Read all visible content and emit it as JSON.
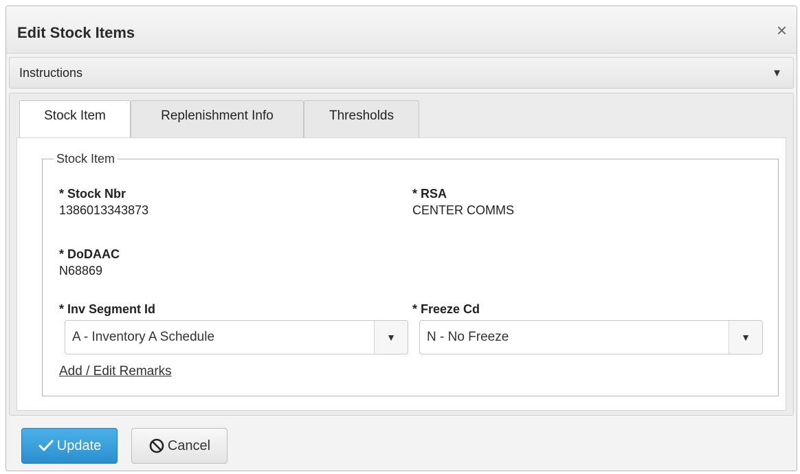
{
  "dialog": {
    "title": "Edit Stock Items",
    "close_icon": "close-icon",
    "close_glyph": "×"
  },
  "instructions": {
    "label": "Instructions",
    "icon": "caret-down-icon",
    "glyph": "▼"
  },
  "tabs": [
    {
      "label": "Stock Item",
      "active": true
    },
    {
      "label": "Replenishment Info",
      "active": false
    },
    {
      "label": "Thresholds",
      "active": false
    }
  ],
  "stock_item": {
    "legend": "Stock Item",
    "stock_nbr_label": "* Stock Nbr",
    "stock_nbr_value": "1386013343873",
    "rsa_label": "* RSA",
    "rsa_value": "CENTER COMMS",
    "dodaac_label": "* DoDAAC",
    "dodaac_value": "N68869",
    "inv_segment_label": "* Inv Segment Id",
    "inv_segment_value": "A - Inventory A Schedule",
    "freeze_label": "* Freeze Cd",
    "freeze_value": "N - No Freeze",
    "select_glyph": "▼",
    "remarks_link": "Add / Edit Remarks"
  },
  "buttons": {
    "update_label": "Update",
    "update_icon": "checkmark-icon",
    "cancel_label": "Cancel",
    "cancel_icon": "prohibited-icon"
  },
  "colors": {
    "primary": "#2a8fd0",
    "background": "#f3f3f3"
  }
}
